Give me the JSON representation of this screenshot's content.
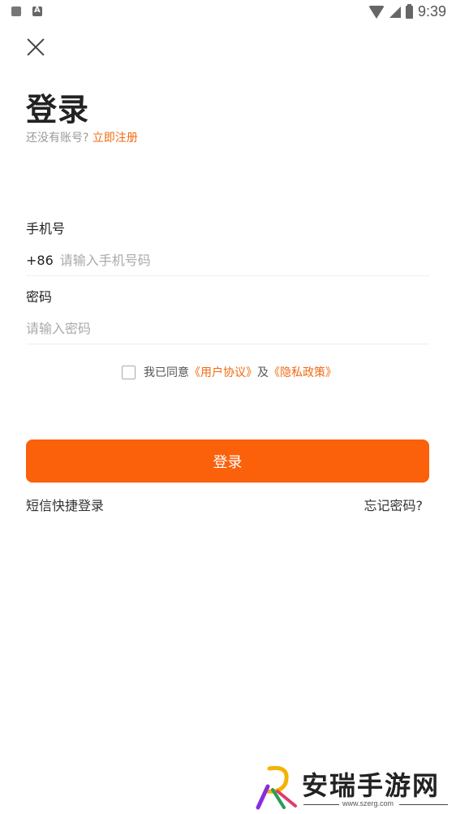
{
  "status_bar": {
    "time": "9:39",
    "icons": [
      "notification-icon",
      "app-a-icon",
      "wifi-icon",
      "signal-icon",
      "battery-icon"
    ]
  },
  "header": {
    "close_icon": "close-icon",
    "title": "登录",
    "subtitle_prefix": "还没有账号?",
    "register_link": "立即注册"
  },
  "form": {
    "phone": {
      "label": "手机号",
      "prefix": "+86",
      "placeholder": "请输入手机号码",
      "value": ""
    },
    "password": {
      "label": "密码",
      "placeholder": "请输入密码",
      "value": ""
    },
    "agreement": {
      "checked": false,
      "prefix": "我已同意",
      "user_agreement": "《用户协议》",
      "conjunction": "及",
      "privacy_policy": "《隐私政策》"
    },
    "submit_label": "登录"
  },
  "footer_links": {
    "sms_login": "短信快捷登录",
    "forgot_password": "忘记密码?"
  },
  "watermark": {
    "text": "安瑞手游网",
    "url": "www.szerg.com"
  },
  "colors": {
    "accent": "#fb600a",
    "link": "#f06a12"
  }
}
